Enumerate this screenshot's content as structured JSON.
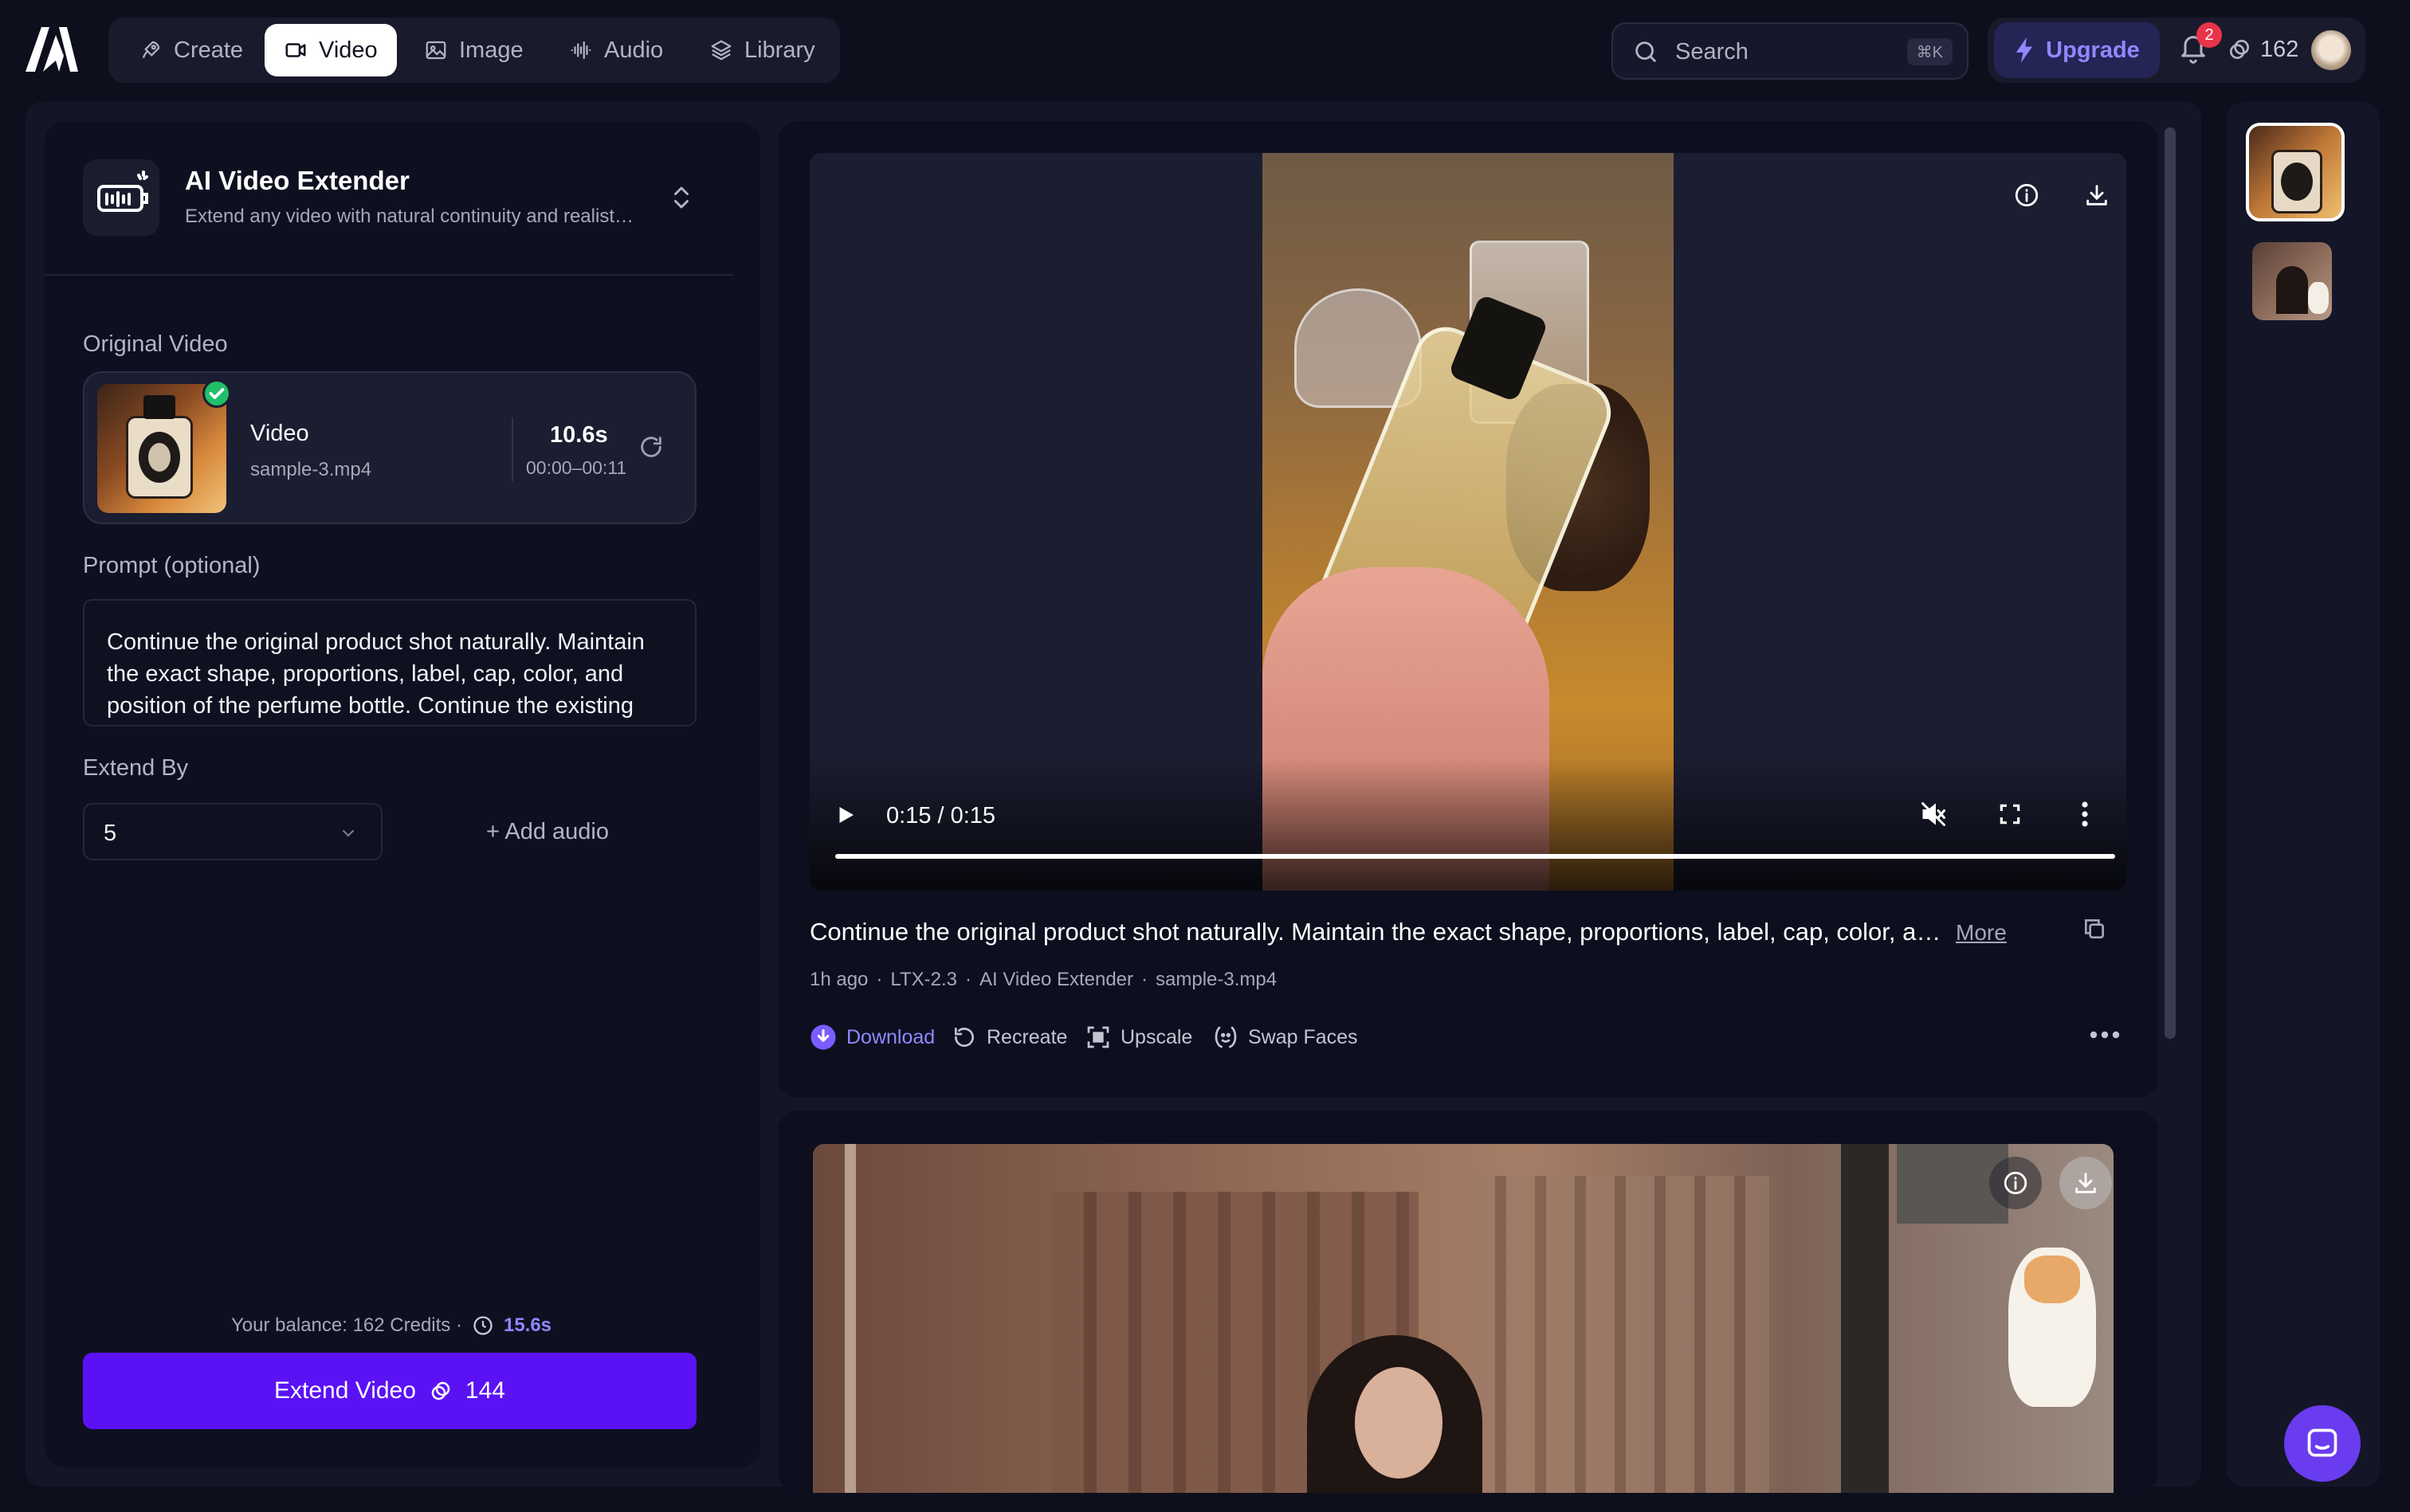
{
  "nav": {
    "items": [
      {
        "label": "Create",
        "icon": "rocket-icon"
      },
      {
        "label": "Video",
        "icon": "video-camera-icon",
        "active": true
      },
      {
        "label": "Image",
        "icon": "image-icon"
      },
      {
        "label": "Audio",
        "icon": "audio-wave-icon"
      },
      {
        "label": "Library",
        "icon": "layers-icon"
      }
    ],
    "search_placeholder": "Search",
    "search_shortcut": "⌘K",
    "upgrade_label": "Upgrade",
    "notification_count": "2",
    "credits": "162"
  },
  "tool": {
    "title": "AI Video Extender",
    "subtitle": "Extend any video with natural continuity and realist…"
  },
  "form": {
    "original_video_label": "Original Video",
    "video_title": "Video",
    "video_filename": "sample-3.mp4",
    "video_duration": "10.6s",
    "video_range": "00:00–00:11",
    "prompt_label": "Prompt (optional)",
    "prompt_text": "Continue the original product shot naturally. Maintain the exact shape, proportions, label, cap, color, and position of the perfume bottle. Continue the existing camera",
    "extend_by_label": "Extend By",
    "extend_by_value": "5",
    "add_audio_label": "+ Add audio",
    "balance_text": "Your balance: 162 Credits ·",
    "balance_time": "15.6s",
    "extend_button_label": "Extend Video",
    "extend_button_cost": "144"
  },
  "result": {
    "time_display": "0:15 / 0:15",
    "progress": 1.0,
    "prompt_preview": "Continue the original product shot naturally. Maintain the exact shape, proportions, label, cap, color, a…",
    "more_label": "More",
    "meta": [
      "1h ago",
      "LTX-2.3",
      "AI Video Extender",
      "sample-3.mp4"
    ],
    "actions": [
      {
        "label": "Download",
        "icon": "download-circle-icon"
      },
      {
        "label": "Recreate",
        "icon": "recreate-icon"
      },
      {
        "label": "Upscale",
        "icon": "upscale-icon"
      },
      {
        "label": "Swap Faces",
        "icon": "swap-faces-icon"
      }
    ]
  },
  "colors": {
    "accent": "#5a12f5",
    "accent_text": "#8f88ff",
    "background": "#0d0f1c",
    "panel": "#141627"
  }
}
